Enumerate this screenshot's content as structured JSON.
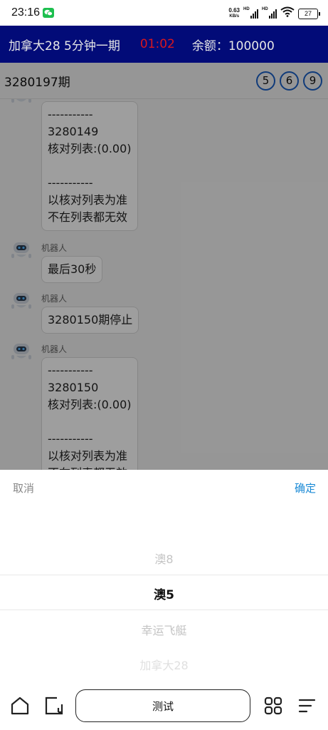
{
  "status_bar": {
    "time": "23:16",
    "net_speed_value": "0.63",
    "net_speed_unit": "KB/s",
    "hd1": "HD",
    "hd2": "HD",
    "battery": "27"
  },
  "header": {
    "title": "加拿大28 5分钟一期",
    "countdown": "01:02",
    "balance": "余额：100000"
  },
  "period_bar": {
    "period": "3280197期",
    "balls": [
      "5",
      "6",
      "9"
    ]
  },
  "chat": {
    "messages": [
      {
        "sender": "机器人",
        "text": "-----------\n3280149\n核对列表:(0.00)\n\n-----------\n以核对列表为准\n不在列表都无效"
      },
      {
        "sender": "机器人",
        "text": "最后30秒"
      },
      {
        "sender": "机器人",
        "text": "3280150期停止"
      },
      {
        "sender": "机器人",
        "text": "-----------\n3280150\n核对列表:(0.00)\n\n-----------\n以核对列表为准\n不在列表都无效"
      }
    ]
  },
  "picker": {
    "cancel_label": "取消",
    "confirm_label": "确定",
    "options": [
      "澳8",
      "澳5",
      "幸运飞艇",
      "加拿大28"
    ],
    "selected_index": 1
  },
  "bottom_bar": {
    "test_label": "测试"
  },
  "colors": {
    "header_bg": "#020b78",
    "countdown": "#d9161e",
    "confirm": "#1a8ad6",
    "ball_border": "#1a5fc6"
  }
}
